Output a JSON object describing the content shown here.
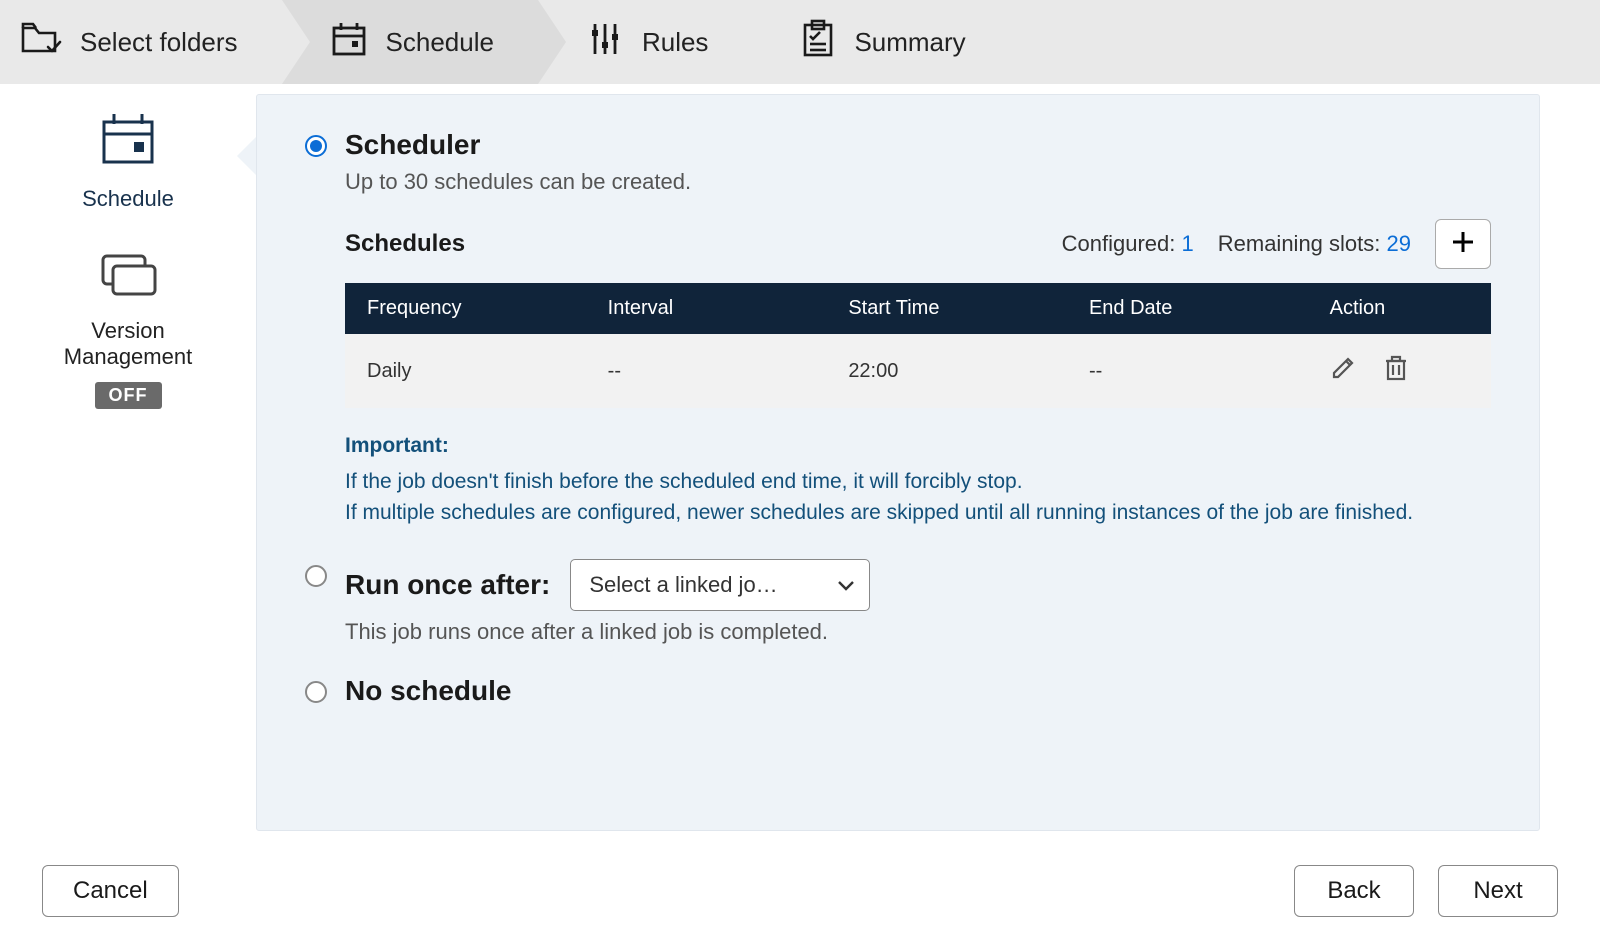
{
  "wizard": {
    "steps": [
      {
        "id": "select-folders",
        "label": "Select folders"
      },
      {
        "id": "schedule",
        "label": "Schedule",
        "active": true
      },
      {
        "id": "rules",
        "label": "Rules"
      },
      {
        "id": "summary",
        "label": "Summary"
      }
    ]
  },
  "sidebar": {
    "items": [
      {
        "id": "schedule",
        "label": "Schedule",
        "active": true
      },
      {
        "id": "version",
        "label_line1": "Version",
        "label_line2": "Management",
        "badge": "OFF"
      }
    ]
  },
  "scheduler": {
    "title": "Scheduler",
    "subtitle": "Up to 30 schedules can be created.",
    "schedules_label": "Schedules",
    "configured_label": "Configured:",
    "configured_count": "1",
    "remaining_label": "Remaining slots:",
    "remaining_count": "29",
    "columns": {
      "frequency": "Frequency",
      "interval": "Interval",
      "start_time": "Start Time",
      "end_date": "End Date",
      "action": "Action"
    },
    "rows": [
      {
        "frequency": "Daily",
        "interval": "--",
        "start_time": "22:00",
        "end_date": "--"
      }
    ],
    "important_header": "Important:",
    "important_line1": "If the job doesn't finish before the scheduled end time, it will forcibly stop.",
    "important_line2": "If multiple schedules are configured, newer schedules are skipped until all running instances of the job are finished."
  },
  "run_once": {
    "title": "Run once after:",
    "placeholder": "Select a linked jo…",
    "desc": "This job runs once after a linked job is completed."
  },
  "no_schedule": {
    "title": "No schedule"
  },
  "footer": {
    "cancel": "Cancel",
    "back": "Back",
    "next": "Next"
  }
}
